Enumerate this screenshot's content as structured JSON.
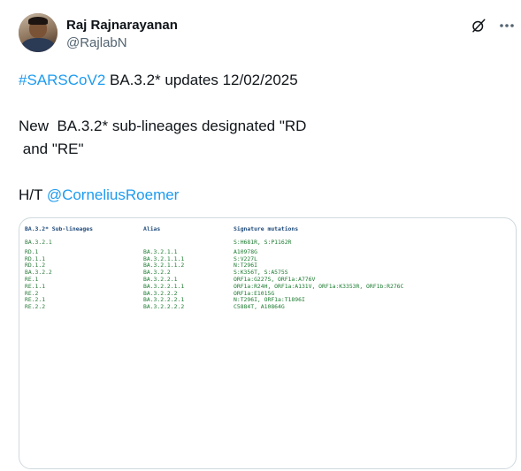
{
  "author": {
    "name": "Raj Rajnarayanan",
    "handle": "@RajlabN"
  },
  "post": {
    "hashtag": "#SARSCoV2",
    "line1_rest": " BA.3.2* updates 12/02/2025",
    "line2": "New  BA.3.2* sub-lineages designated \"RD\n and \"RE\"",
    "ht_prefix": "H/T ",
    "mention": "@CorneliusRoemer"
  },
  "icons": {
    "grok": "grok-icon",
    "more": "more-icon"
  },
  "table": {
    "headers": [
      "BA.3.2* Sub-lineages",
      "Alias",
      "Signature mutations"
    ],
    "rows": [
      [
        "BA.3.2.1",
        "",
        "S:H681R, S:P1162R"
      ],
      [
        "RD.1",
        "BA.3.2.1.1",
        "A10978G"
      ],
      [
        "RD.1.1",
        "BA.3.2.1.1.1",
        "S:V227L"
      ],
      [
        "RD.1.2",
        "BA.3.2.1.1.2",
        "N:T296I"
      ],
      [
        "BA.3.2.2",
        "BA.3.2.2",
        "S:K356T, S:A575S"
      ],
      [
        "RE.1",
        "BA.3.2.2.1",
        "ORF1a:G227S, ORF1a:A776V"
      ],
      [
        "RE.1.1",
        "BA.3.2.2.1.1",
        "ORF1a:R24H, ORF1a:A131V, ORF1a:K3353R, ORF1b:R276C"
      ],
      [
        "RE.2",
        "BA.3.2.2.2",
        "ORF1a:E1015G"
      ],
      [
        "RE.2.1",
        "BA.3.2.2.2.1",
        "N:T296I, ORF1a:T1896I"
      ],
      [
        "RE.2.2",
        "BA.3.2.2.2.2",
        "C5884T, A10864G"
      ]
    ]
  }
}
